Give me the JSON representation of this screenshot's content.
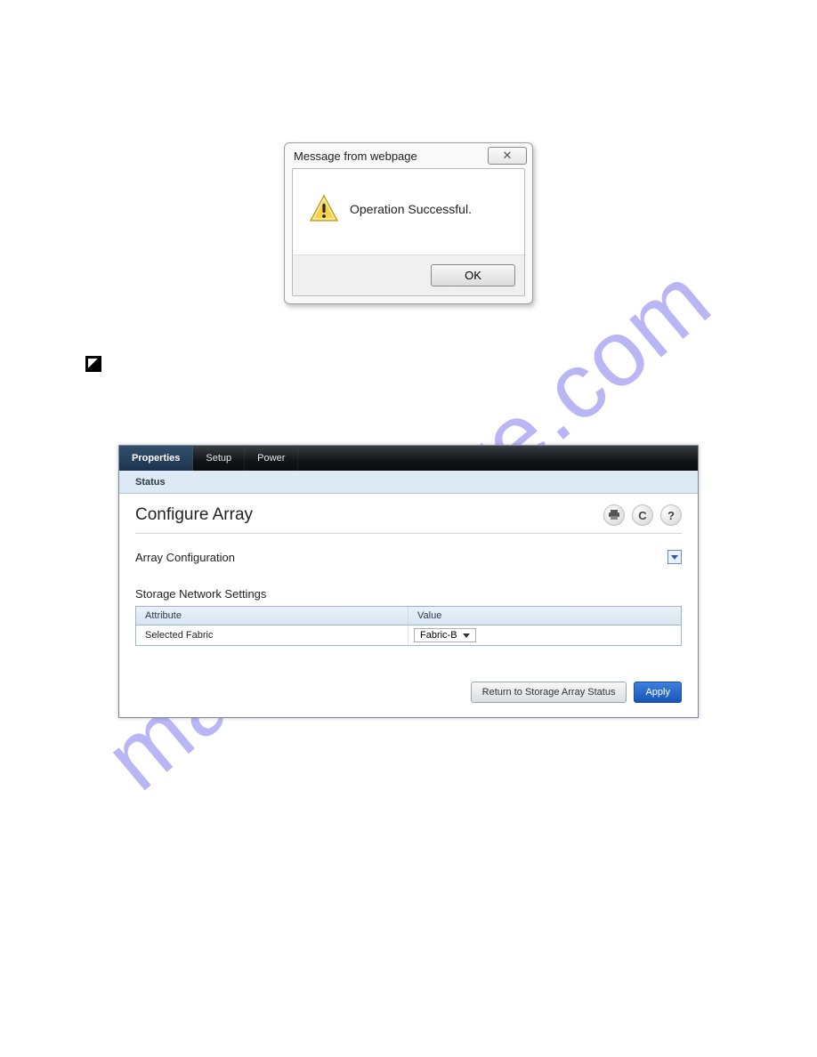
{
  "watermark": "manualshive.com",
  "dialog": {
    "title": "Message from webpage",
    "close_glyph": "✕",
    "message": "Operation Successful.",
    "ok_label": "OK"
  },
  "panel": {
    "tabs": [
      "Properties",
      "Setup",
      "Power"
    ],
    "subtab": "Status",
    "title": "Configure Array",
    "icons": {
      "print": "⎙",
      "refresh": "C",
      "help": "?"
    },
    "section": "Array Configuration",
    "subheading": "Storage Network Settings",
    "grid": {
      "head_attr": "Attribute",
      "head_val": "Value",
      "row_attr": "Selected Fabric",
      "row_val": "Fabric-B"
    },
    "buttons": {
      "return": "Return to Storage Array Status",
      "apply": "Apply"
    }
  }
}
